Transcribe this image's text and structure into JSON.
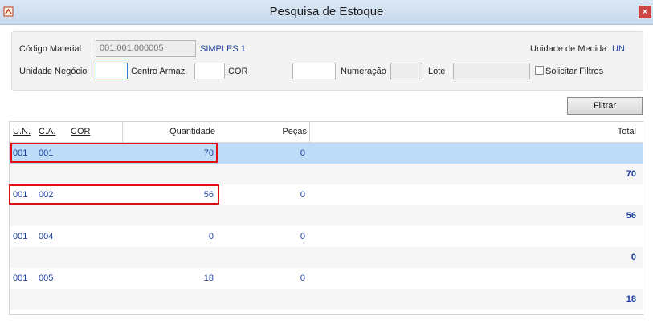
{
  "window": {
    "title": "Pesquisa de Estoque",
    "close_label": "×"
  },
  "form": {
    "codigo_material_label": "Código Material",
    "codigo_material_value": "001.001.000005",
    "material_desc": "SIMPLES 1",
    "unidade_medida_label": "Unidade de Medida",
    "unidade_medida_value": "UN",
    "unidade_negocio_label": "Unidade Negócio",
    "centro_armaz_label": "Centro Armaz.",
    "cor_label": "COR",
    "numeracao_label": "Numeração",
    "lote_label": "Lote",
    "solicitar_filtros_label": "Solicitar Filtros"
  },
  "filtrar_label": "Filtrar",
  "grid": {
    "columns": {
      "un": "U.N.",
      "ca": "C.A.",
      "cor": "COR",
      "quantidade": "Quantidade",
      "pecas": "Peças",
      "total": "Total"
    },
    "rows": [
      {
        "un": "001",
        "ca": "001",
        "quantidade": "70",
        "pecas": "0",
        "total": "70"
      },
      {
        "un": "001",
        "ca": "002",
        "quantidade": "56",
        "pecas": "0",
        "total": "56"
      },
      {
        "un": "001",
        "ca": "004",
        "quantidade": "0",
        "pecas": "0",
        "total": "0"
      },
      {
        "un": "001",
        "ca": "005",
        "quantidade": "18",
        "pecas": "0",
        "total": "18"
      }
    ]
  }
}
